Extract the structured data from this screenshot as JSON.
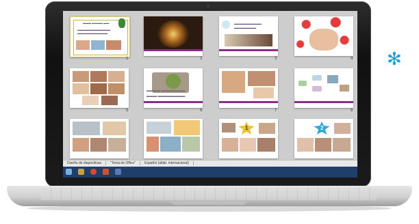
{
  "statusbar": {
    "view_label": "Diseño de diapositivas",
    "theme_label": "\"Tema de Office\"",
    "language_label": "Español (alfab. internacional)"
  },
  "slide_numbers": [
    "1",
    "2",
    "3",
    "4",
    "5",
    "6",
    "7",
    "8",
    "9",
    "10",
    "11",
    "12"
  ],
  "slide_badges": {
    "s11": "1",
    "s12": "2"
  },
  "colors": {
    "accent": "#1da1d9",
    "taskbar": "#1f3f6a",
    "slide_border": "#8c2a8c"
  },
  "icons": [
    "asterisk-icon",
    "start-icon",
    "explorer-icon",
    "chrome-icon",
    "powerpoint-icon"
  ]
}
